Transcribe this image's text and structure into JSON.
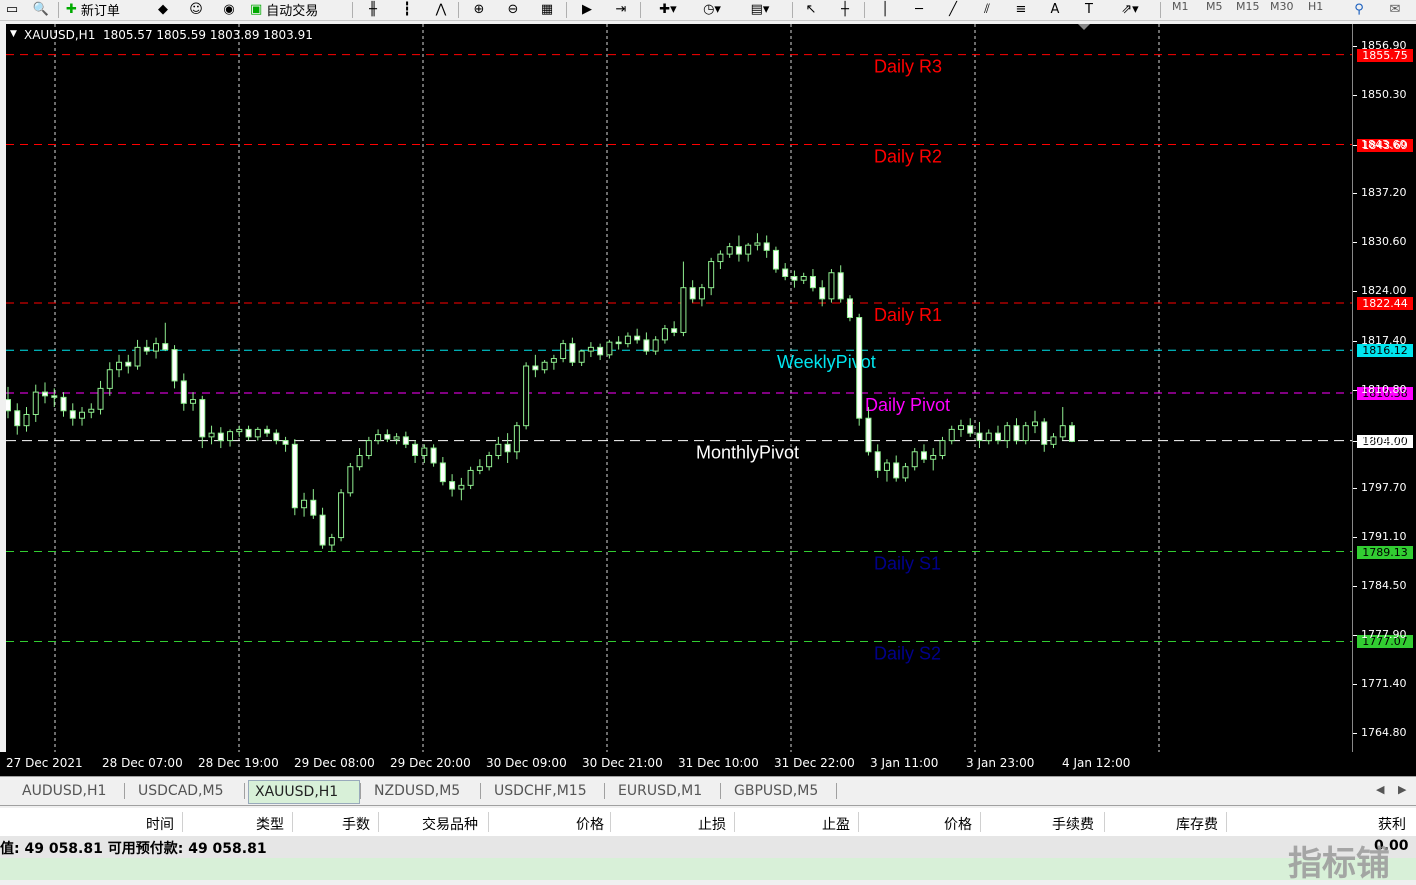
{
  "toolbar": {
    "new_order_label": "新订单",
    "auto_trade_label": "自动交易",
    "timeframes": [
      "M1",
      "M5",
      "M15",
      "M30",
      "H1"
    ]
  },
  "chart": {
    "symbol_header": "XAUUSD,H1  1805.57 1805.59 1803.89 1803.91",
    "pivots": [
      {
        "label": "Daily R3",
        "price": "1855.75",
        "color": "#ff0000",
        "tag_bg": "#ff0000",
        "tag_fg": "#ffffff"
      },
      {
        "label": "Daily R2",
        "price": "1843.69",
        "color": "#ff0000",
        "tag_bg": "#ff0000",
        "tag_fg": "#ffffff"
      },
      {
        "label": "Daily R1",
        "price": "1822.44",
        "color": "#ff0000",
        "tag_bg": "#ff0000",
        "tag_fg": "#ffffff"
      },
      {
        "label": "WeeklyPivot",
        "price": "1816.12",
        "color": "#00e5ee",
        "tag_bg": "#00e5ee",
        "tag_fg": "#000000"
      },
      {
        "label": "Daily Pivot",
        "price": "1810.38",
        "color": "#ff00ff",
        "tag_bg": "#ff00ff",
        "tag_fg": "#000000"
      },
      {
        "label": "MonthlyPivot",
        "price": "1804.00",
        "color": "#ffffff",
        "tag_bg": "#ffffff",
        "tag_fg": "#000000"
      },
      {
        "label": "Daily S1",
        "price": "1789.13",
        "color": "#00008b",
        "tag_bg": "#32cd32",
        "tag_fg": "#000000"
      },
      {
        "label": "Daily S2",
        "price": "1777.07",
        "color": "#00008b",
        "tag_bg": "#32cd32",
        "tag_fg": "#000000"
      }
    ],
    "price_labels": [
      "1856.90",
      "1850.30",
      "1843.60",
      "1837.20",
      "1830.60",
      "1824.00",
      "1817.40",
      "1810.80",
      "1804.00",
      "1797.70",
      "1791.10",
      "1784.50",
      "1777.90",
      "1771.40",
      "1764.80"
    ],
    "time_labels": [
      "27 Dec 2021",
      "28 Dec 07:00",
      "28 Dec 19:00",
      "29 Dec 08:00",
      "29 Dec 20:00",
      "30 Dec 09:00",
      "30 Dec 21:00",
      "31 Dec 10:00",
      "31 Dec 22:00",
      "3 Jan 11:00",
      "3 Jan 23:00",
      "4 Jan 12:00"
    ]
  },
  "chart_data": {
    "type": "candlestick",
    "title": "XAUUSD,H1",
    "ylim": [
      1762.0,
      1860.0
    ],
    "candles": [
      [
        1809.5,
        1811.2,
        1807.0,
        1808.0
      ],
      [
        1808.0,
        1809.0,
        1804.8,
        1806.0
      ],
      [
        1806.0,
        1808.5,
        1805.2,
        1807.5
      ],
      [
        1807.5,
        1811.5,
        1806.5,
        1810.5
      ],
      [
        1810.5,
        1811.8,
        1809.0,
        1810.0
      ],
      [
        1810.0,
        1811.0,
        1808.5,
        1809.8
      ],
      [
        1809.8,
        1810.5,
        1807.2,
        1808.0
      ],
      [
        1808.0,
        1809.0,
        1806.0,
        1807.0
      ],
      [
        1807.0,
        1808.5,
        1806.0,
        1807.8
      ],
      [
        1807.8,
        1809.0,
        1807.0,
        1808.2
      ],
      [
        1808.2,
        1812.0,
        1807.5,
        1811.0
      ],
      [
        1811.0,
        1814.5,
        1810.0,
        1813.5
      ],
      [
        1813.5,
        1815.5,
        1812.5,
        1814.5
      ],
      [
        1814.5,
        1815.5,
        1813.0,
        1814.0
      ],
      [
        1814.0,
        1817.5,
        1813.5,
        1816.5
      ],
      [
        1816.5,
        1817.5,
        1815.5,
        1816.0
      ],
      [
        1816.0,
        1817.8,
        1815.0,
        1817.0
      ],
      [
        1817.0,
        1819.8,
        1816.0,
        1816.2
      ],
      [
        1816.2,
        1816.8,
        1811.0,
        1812.0
      ],
      [
        1812.0,
        1813.0,
        1808.0,
        1809.0
      ],
      [
        1809.0,
        1810.5,
        1808.0,
        1809.5
      ],
      [
        1809.5,
        1810.0,
        1803.0,
        1804.5
      ],
      [
        1804.5,
        1806.0,
        1803.5,
        1805.0
      ],
      [
        1805.0,
        1805.8,
        1803.0,
        1804.0
      ],
      [
        1804.0,
        1805.5,
        1803.2,
        1805.2
      ],
      [
        1805.2,
        1806.0,
        1804.5,
        1805.5
      ],
      [
        1805.5,
        1806.0,
        1804.0,
        1804.5
      ],
      [
        1804.5,
        1805.8,
        1804.0,
        1805.5
      ],
      [
        1805.5,
        1806.0,
        1804.5,
        1805.0
      ],
      [
        1805.0,
        1805.5,
        1803.5,
        1804.0
      ],
      [
        1804.0,
        1804.5,
        1802.5,
        1803.5
      ],
      [
        1803.5,
        1804.2,
        1794.0,
        1795.0
      ],
      [
        1795.0,
        1797.0,
        1793.8,
        1796.0
      ],
      [
        1796.0,
        1797.5,
        1793.5,
        1794.0
      ],
      [
        1794.0,
        1795.0,
        1789.5,
        1790.0
      ],
      [
        1790.0,
        1791.5,
        1789.2,
        1791.0
      ],
      [
        1791.0,
        1797.5,
        1790.5,
        1797.0
      ],
      [
        1797.0,
        1801.0,
        1796.5,
        1800.5
      ],
      [
        1800.5,
        1803.0,
        1800.0,
        1802.0
      ],
      [
        1802.0,
        1804.5,
        1801.5,
        1804.0
      ],
      [
        1804.0,
        1805.5,
        1803.5,
        1804.8
      ],
      [
        1804.8,
        1805.5,
        1803.8,
        1804.2
      ],
      [
        1804.2,
        1805.0,
        1803.5,
        1804.5
      ],
      [
        1804.5,
        1805.2,
        1803.0,
        1803.5
      ],
      [
        1803.5,
        1804.0,
        1801.0,
        1802.0
      ],
      [
        1802.0,
        1803.5,
        1801.0,
        1803.0
      ],
      [
        1803.0,
        1803.5,
        1800.5,
        1801.0
      ],
      [
        1801.0,
        1801.8,
        1798.0,
        1798.5
      ],
      [
        1798.5,
        1799.5,
        1796.5,
        1797.5
      ],
      [
        1797.5,
        1799.0,
        1796.0,
        1798.0
      ],
      [
        1798.0,
        1800.5,
        1797.5,
        1800.0
      ],
      [
        1800.0,
        1801.5,
        1799.5,
        1800.5
      ],
      [
        1800.5,
        1802.5,
        1800.0,
        1802.0
      ],
      [
        1802.0,
        1804.5,
        1801.5,
        1803.5
      ],
      [
        1803.5,
        1805.0,
        1801.0,
        1802.5
      ],
      [
        1802.5,
        1806.5,
        1801.5,
        1806.0
      ],
      [
        1806.0,
        1814.5,
        1805.5,
        1814.0
      ],
      [
        1814.0,
        1815.5,
        1812.5,
        1813.5
      ],
      [
        1813.5,
        1814.8,
        1813.0,
        1814.5
      ],
      [
        1814.5,
        1815.5,
        1813.5,
        1815.0
      ],
      [
        1815.0,
        1817.5,
        1814.5,
        1817.0
      ],
      [
        1817.0,
        1817.8,
        1814.0,
        1814.5
      ],
      [
        1814.5,
        1816.2,
        1814.0,
        1816.0
      ],
      [
        1816.0,
        1817.2,
        1815.2,
        1816.5
      ],
      [
        1816.5,
        1817.0,
        1814.8,
        1815.5
      ],
      [
        1815.5,
        1817.5,
        1815.0,
        1817.2
      ],
      [
        1817.2,
        1818.0,
        1816.2,
        1817.0
      ],
      [
        1817.0,
        1818.5,
        1816.5,
        1818.0
      ],
      [
        1818.0,
        1819.0,
        1817.0,
        1817.5
      ],
      [
        1817.5,
        1818.5,
        1815.5,
        1816.0
      ],
      [
        1816.0,
        1818.0,
        1815.5,
        1817.5
      ],
      [
        1817.5,
        1819.5,
        1817.0,
        1819.0
      ],
      [
        1819.0,
        1820.0,
        1818.0,
        1818.5
      ],
      [
        1818.5,
        1828.0,
        1818.0,
        1824.5
      ],
      [
        1824.5,
        1825.5,
        1822.5,
        1823.0
      ],
      [
        1823.0,
        1825.0,
        1822.0,
        1824.5
      ],
      [
        1824.5,
        1828.5,
        1823.5,
        1828.0
      ],
      [
        1828.0,
        1829.5,
        1827.0,
        1829.0
      ],
      [
        1829.0,
        1830.5,
        1828.5,
        1830.0
      ],
      [
        1830.0,
        1831.5,
        1828.0,
        1829.0
      ],
      [
        1829.0,
        1830.5,
        1828.0,
        1830.2
      ],
      [
        1830.2,
        1831.8,
        1829.5,
        1830.5
      ],
      [
        1830.5,
        1831.5,
        1828.5,
        1829.5
      ],
      [
        1829.5,
        1830.0,
        1826.5,
        1827.0
      ],
      [
        1827.0,
        1827.8,
        1825.5,
        1826.0
      ],
      [
        1826.0,
        1826.8,
        1824.5,
        1825.5
      ],
      [
        1825.5,
        1826.5,
        1825.0,
        1826.0
      ],
      [
        1826.0,
        1827.0,
        1824.0,
        1824.5
      ],
      [
        1824.5,
        1825.5,
        1822.0,
        1823.0
      ],
      [
        1823.0,
        1827.0,
        1822.5,
        1826.5
      ],
      [
        1826.5,
        1827.5,
        1822.5,
        1823.0
      ],
      [
        1823.0,
        1823.5,
        1820.0,
        1820.5
      ],
      [
        1820.5,
        1821.0,
        1806.0,
        1807.0
      ],
      [
        1807.0,
        1808.5,
        1802.0,
        1802.5
      ],
      [
        1802.5,
        1803.5,
        1799.0,
        1800.0
      ],
      [
        1800.0,
        1801.5,
        1798.5,
        1801.0
      ],
      [
        1801.0,
        1802.0,
        1798.5,
        1799.0
      ],
      [
        1799.0,
        1801.0,
        1798.5,
        1800.5
      ],
      [
        1800.5,
        1803.0,
        1800.0,
        1802.5
      ],
      [
        1802.5,
        1803.5,
        1801.0,
        1801.5
      ],
      [
        1801.5,
        1803.0,
        1800.0,
        1802.0
      ],
      [
        1802.0,
        1804.5,
        1801.5,
        1804.0
      ],
      [
        1804.0,
        1806.0,
        1803.5,
        1805.5
      ],
      [
        1805.5,
        1806.8,
        1804.5,
        1806.0
      ],
      [
        1806.0,
        1807.0,
        1804.5,
        1805.0
      ],
      [
        1805.0,
        1806.5,
        1803.0,
        1804.0
      ],
      [
        1804.0,
        1805.5,
        1803.5,
        1805.0
      ],
      [
        1805.0,
        1806.0,
        1803.5,
        1804.0
      ],
      [
        1804.0,
        1806.5,
        1803.0,
        1806.0
      ],
      [
        1806.0,
        1807.0,
        1803.5,
        1804.0
      ],
      [
        1804.0,
        1806.5,
        1803.5,
        1806.0
      ],
      [
        1806.0,
        1808.0,
        1805.0,
        1806.5
      ],
      [
        1806.5,
        1807.0,
        1802.5,
        1803.5
      ],
      [
        1803.5,
        1805.0,
        1803.0,
        1804.5
      ],
      [
        1804.5,
        1808.5,
        1804.0,
        1806.0
      ],
      [
        1806.0,
        1806.5,
        1803.8,
        1803.9
      ]
    ]
  },
  "tabs": [
    "AUDUSD,H1",
    "USDCAD,M5",
    "XAUUSD,H1",
    "NZDUSD,M5",
    "USDCHF,M15",
    "EURUSD,M1",
    "GBPUSD,M5"
  ],
  "active_tab_index": 2,
  "terminal": {
    "columns": [
      "时间",
      "类型",
      "手数",
      "交易品种",
      "价格",
      "止损",
      "止盈",
      "价格",
      "手续费",
      "库存费",
      "获利"
    ],
    "balance_text": "值: 49 058.81  可用预付款: 49 058.81",
    "profit_value": "0.00"
  },
  "watermark": "指标铺"
}
